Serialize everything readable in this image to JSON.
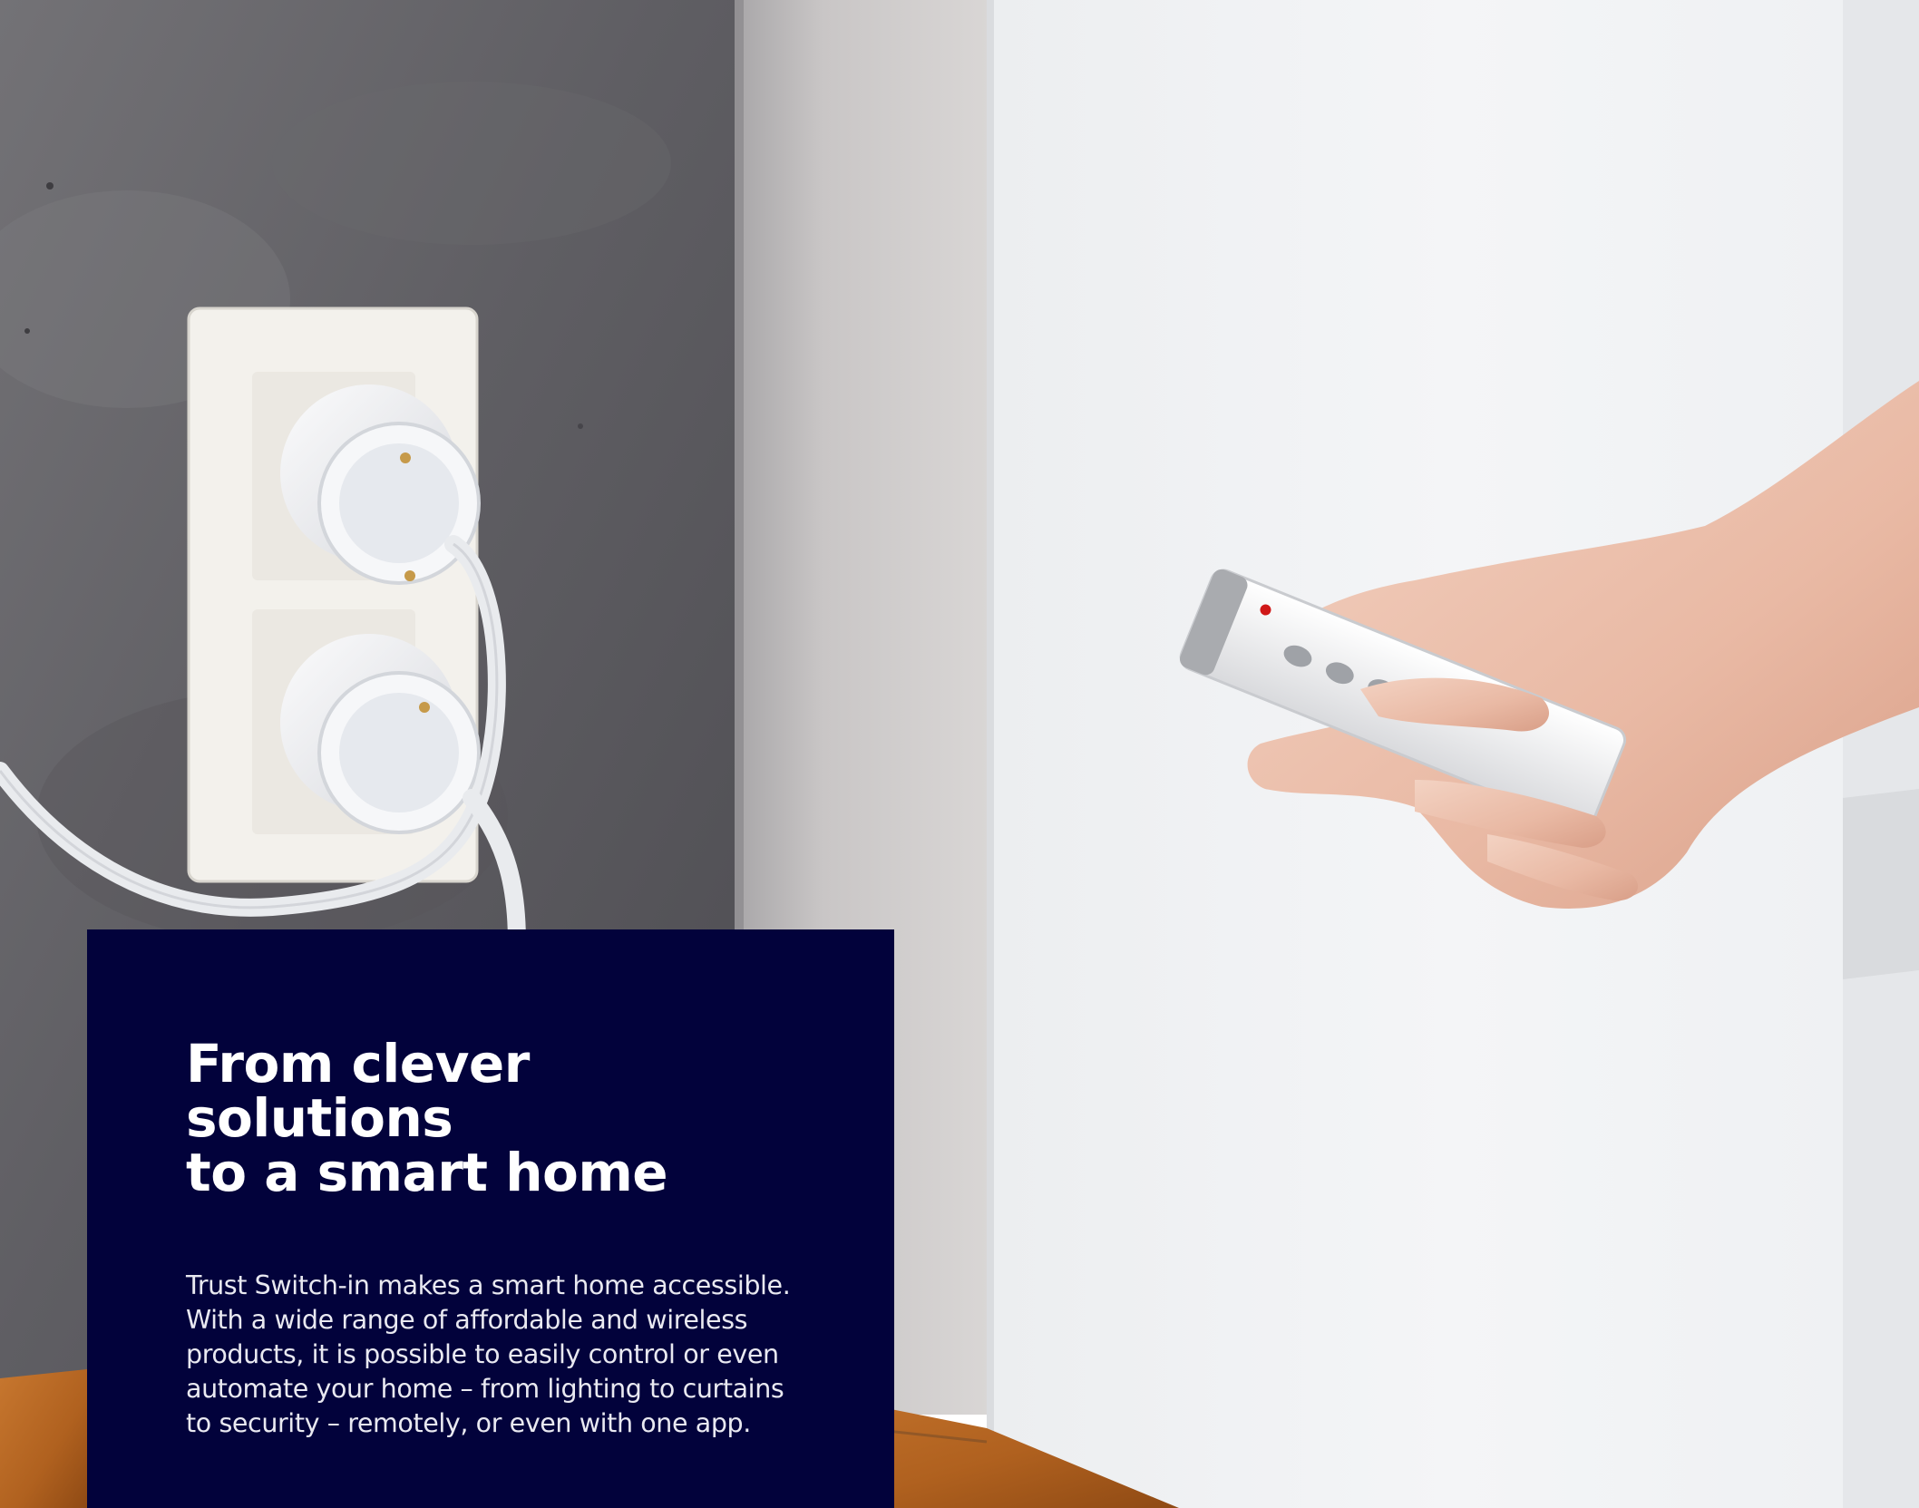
{
  "hero": {
    "scene": "wall-sockets-and-remote-control-photo",
    "colors": {
      "concrete_wall": "#5e5d62",
      "wall_white": "#f1f3f5",
      "floor_wood": "#b9692a",
      "remote_led": "#d01818"
    }
  },
  "panel": {
    "headline": "From clever solutions\nto a smart home",
    "body": "Trust Switch-in makes a smart home accessible.\nWith a wide range of affordable and wireless\nproducts, it is possible to easily control or even\nautomate your home – from lighting to curtains\nto security – remotely, or even with one app.",
    "background": "#02023b",
    "text_color": "#ffffff"
  }
}
